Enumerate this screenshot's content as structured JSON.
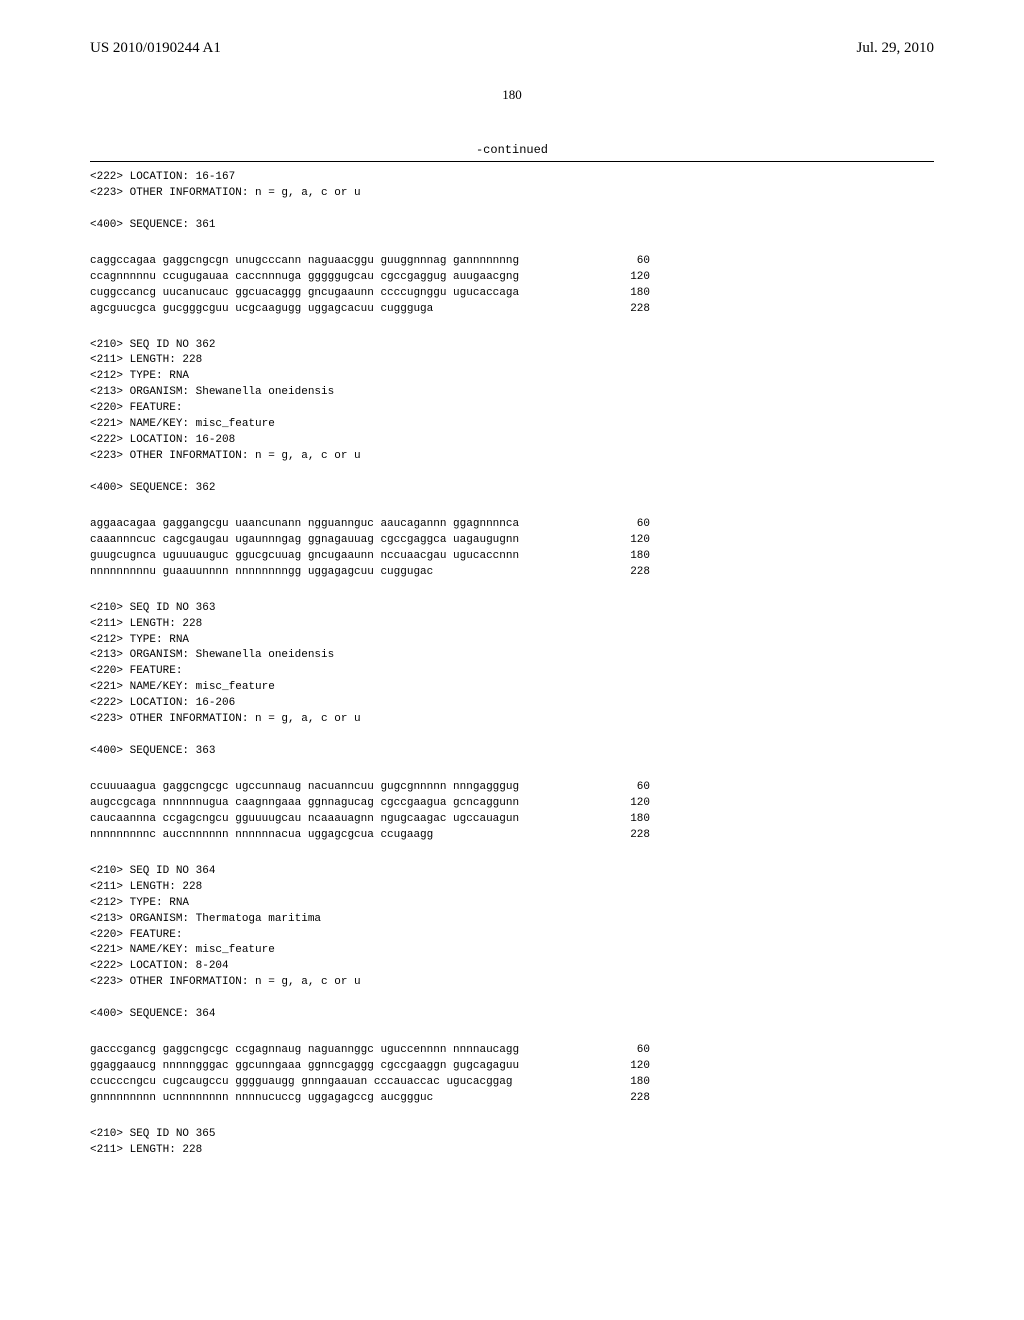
{
  "header": {
    "left": "US 2010/0190244 A1",
    "right": "Jul. 29, 2010"
  },
  "pagenum": "180",
  "continued": "-continued",
  "block_pre": "<222> LOCATION: 16-167\n<223> OTHER INFORMATION: n = g, a, c or u\n\n<400> SEQUENCE: 361",
  "seq361": [
    {
      "seq": "caggccagaa gaggcngcgn unugcccann naguaacggu guuggnnnag gannnnnnng",
      "n": "60"
    },
    {
      "seq": "ccagnnnnnu ccugugauaa caccnnnuga gggggugcau cgccgaggug auugaacgng",
      "n": "120"
    },
    {
      "seq": "cuggccancg uucanucauc ggcuacaggg gncugaaunn ccccugnggu ugucaccaga",
      "n": "180"
    },
    {
      "seq": "agcguucgca gucgggcguu ucgcaagugg uggagcacuu cuggguga",
      "n": "228"
    }
  ],
  "meta362": "<210> SEQ ID NO 362\n<211> LENGTH: 228\n<212> TYPE: RNA\n<213> ORGANISM: Shewanella oneidensis\n<220> FEATURE:\n<221> NAME/KEY: misc_feature\n<222> LOCATION: 16-208\n<223> OTHER INFORMATION: n = g, a, c or u\n\n<400> SEQUENCE: 362",
  "seq362": [
    {
      "seq": "aggaacagaa gaggangcgu uaancunann ngguannguc aaucagannn ggagnnnnca",
      "n": "60"
    },
    {
      "seq": "caaannncuc cagcgaugau ugaunnngag ggnagauuag cgccgaggca uagaugugnn",
      "n": "120"
    },
    {
      "seq": "guugcugnca uguuuauguc ggucgcuuag gncugaaunn nccuaacgau ugucaccnnn",
      "n": "180"
    },
    {
      "seq": "nnnnnnnnnu guaauunnnn nnnnnnnngg uggagagcuu cuggugac",
      "n": "228"
    }
  ],
  "meta363": "<210> SEQ ID NO 363\n<211> LENGTH: 228\n<212> TYPE: RNA\n<213> ORGANISM: Shewanella oneidensis\n<220> FEATURE:\n<221> NAME/KEY: misc_feature\n<222> LOCATION: 16-206\n<223> OTHER INFORMATION: n = g, a, c or u\n\n<400> SEQUENCE: 363",
  "seq363": [
    {
      "seq": "ccuuuaagua gaggcngcgc ugccunnaug nacuanncuu gugcgnnnnn nnngagggug",
      "n": "60"
    },
    {
      "seq": "augccgcaga nnnnnnugua caagnngaaa ggnnagucag cgccgaagua gcncaggunn",
      "n": "120"
    },
    {
      "seq": "caucaannna ccgagcngcu gguuuugcau ncaaauagnn ngugcaagac ugccauagun",
      "n": "180"
    },
    {
      "seq": "nnnnnnnnnc auccnnnnnn nnnnnnacua uggagcgcua ccugaagg",
      "n": "228"
    }
  ],
  "meta364": "<210> SEQ ID NO 364\n<211> LENGTH: 228\n<212> TYPE: RNA\n<213> ORGANISM: Thermatoga maritima\n<220> FEATURE:\n<221> NAME/KEY: misc_feature\n<222> LOCATION: 8-204\n<223> OTHER INFORMATION: n = g, a, c or u\n\n<400> SEQUENCE: 364",
  "seq364": [
    {
      "seq": "gacccgancg gaggcngcgc ccgagnnaug naguannggc uguccennnn nnnnaucagg",
      "n": "60"
    },
    {
      "seq": "ggaggaaucg nnnnngggac ggcunngaaa ggnncgaggg cgccgaaggn gugcagaguu",
      "n": "120"
    },
    {
      "seq": "ccucccngcu cugcaugccu gggguaugg gnnngaauan cccauaccac ugucacggag",
      "n": "180"
    },
    {
      "seq": "gnnnnnnnnn ucnnnnnnnn nnnnucuccg uggagagccg aucggguc",
      "n": "228"
    }
  ],
  "meta365": "<210> SEQ ID NO 365\n<211> LENGTH: 228"
}
